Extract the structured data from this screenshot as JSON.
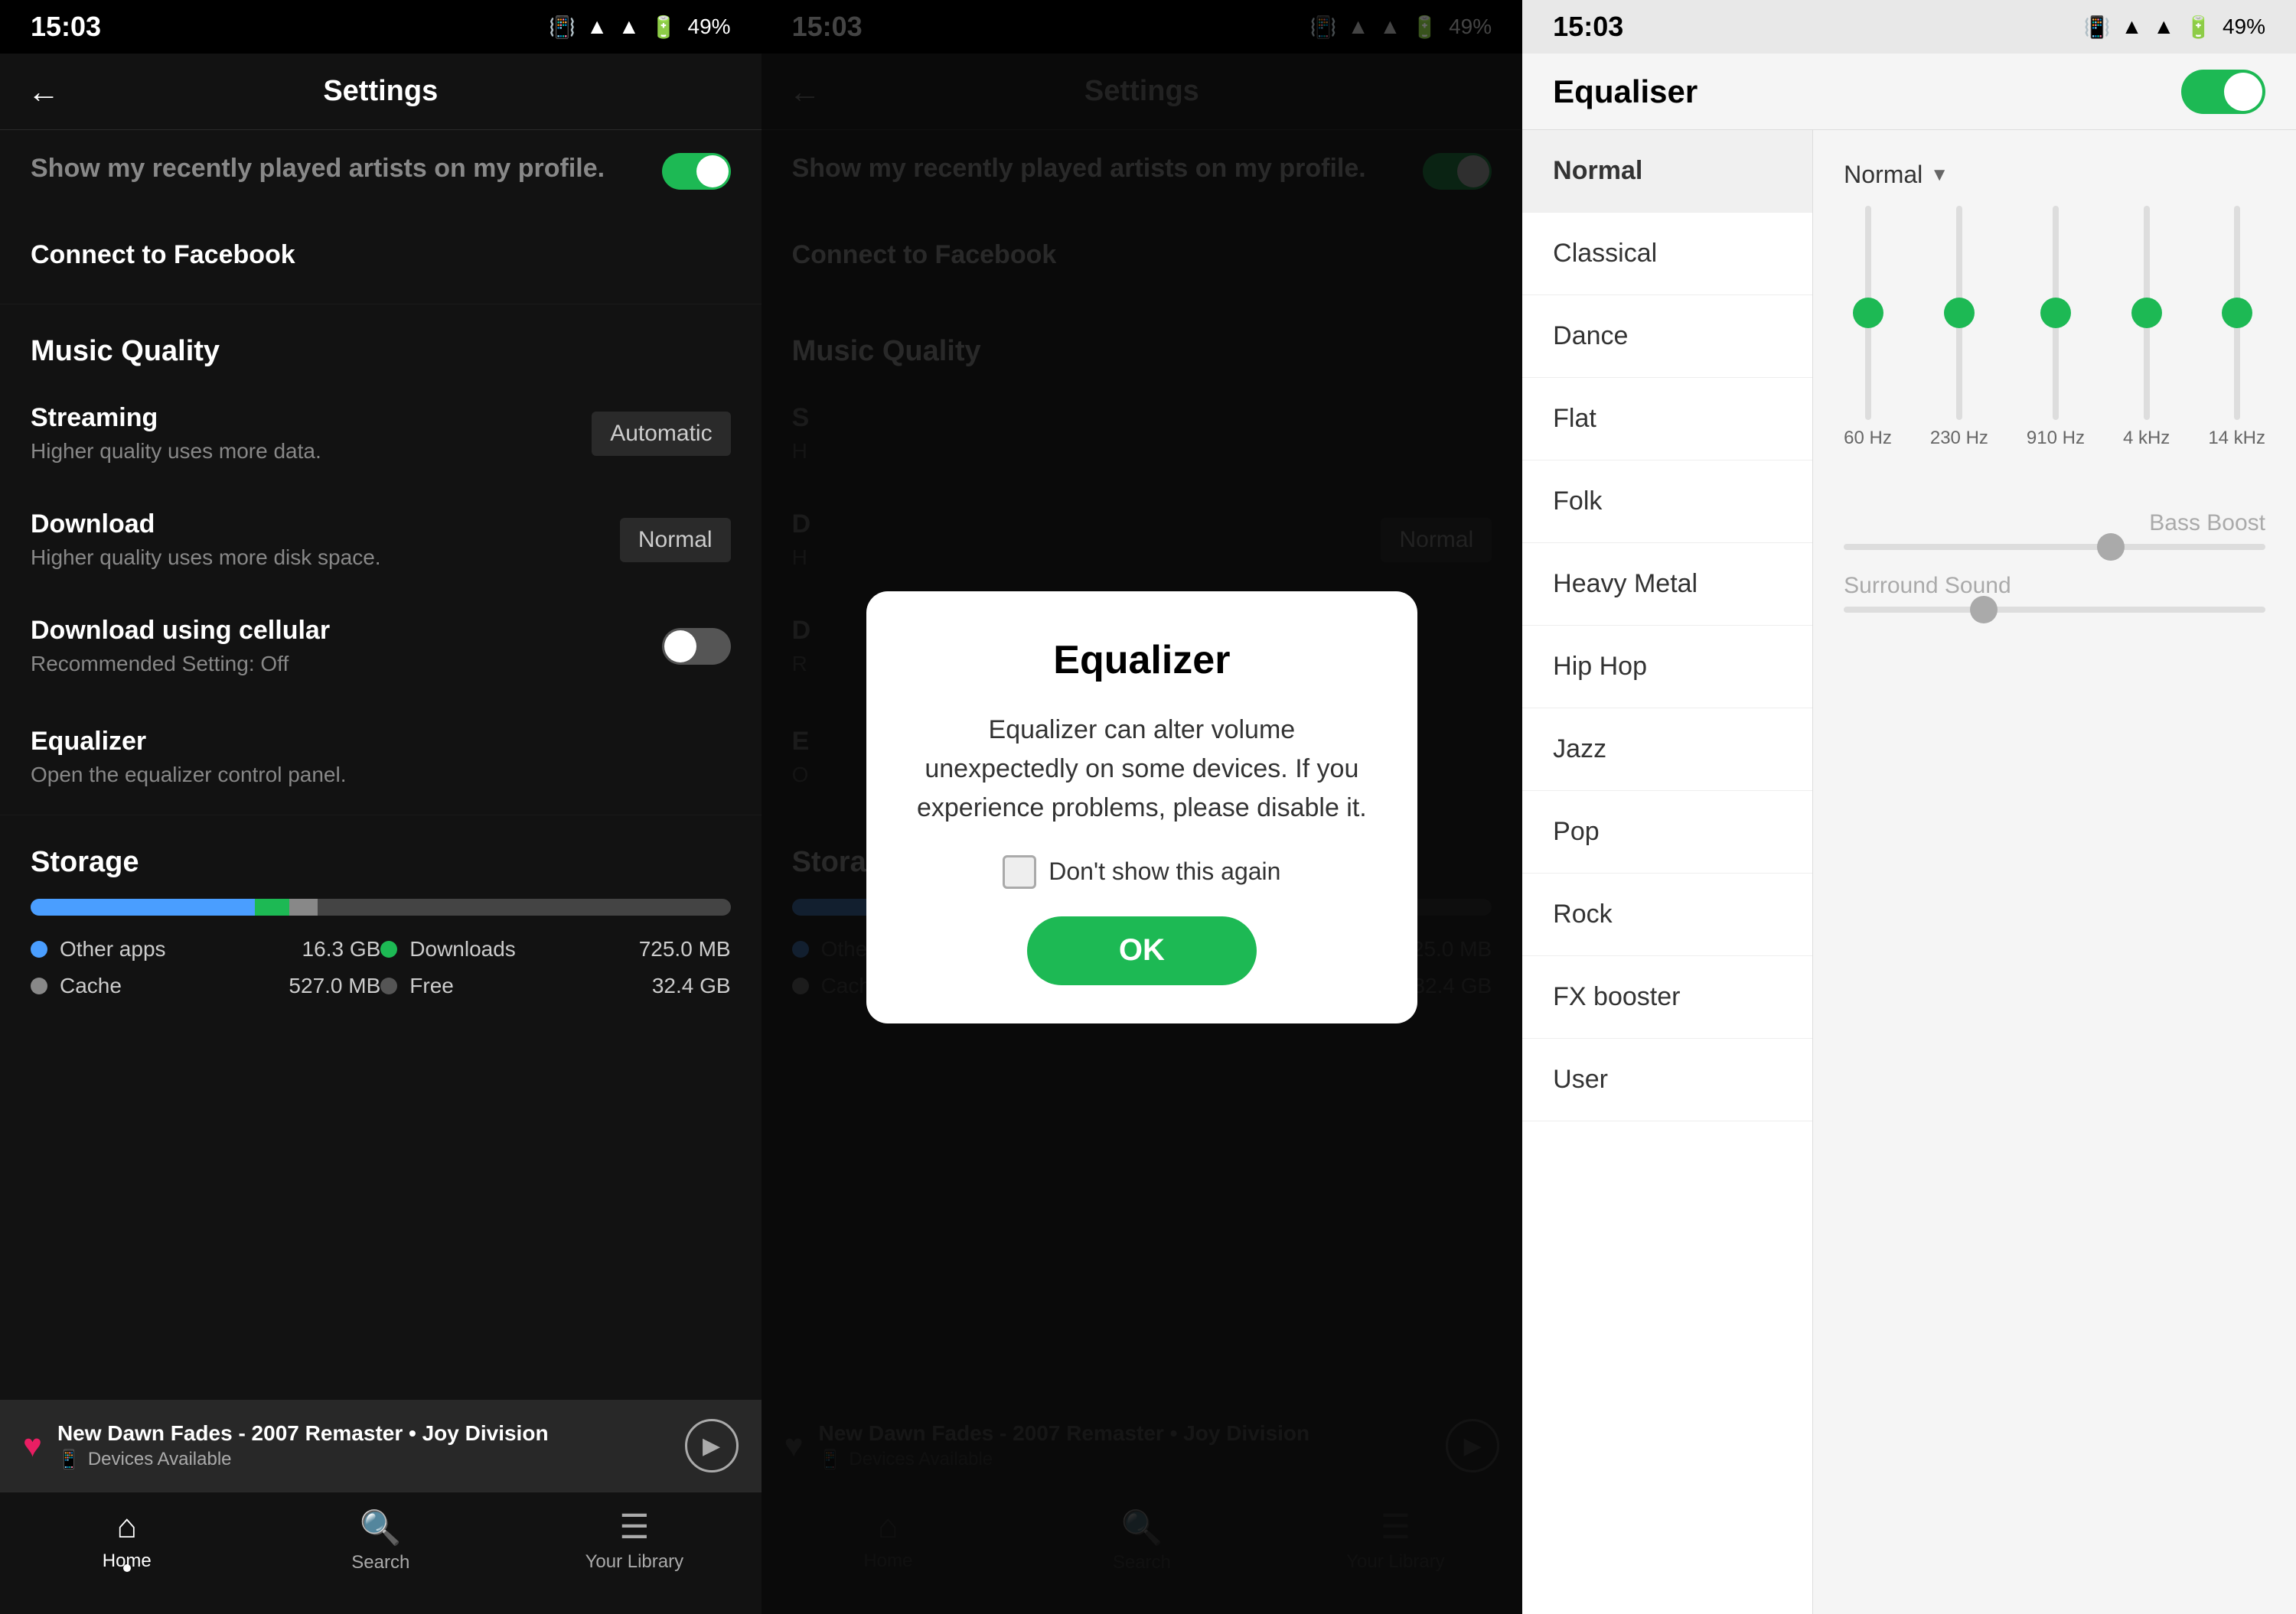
{
  "statusBar": {
    "time": "15:03",
    "battery": "49%"
  },
  "panel1": {
    "title": "Settings",
    "back": "←",
    "recentlyPlayed": "Show my recently played artists on my profile.",
    "connectFacebook": "Connect to Facebook",
    "musicQualitySection": "Music Quality",
    "streamingLabel": "Streaming",
    "streamingDesc": "Higher quality uses more data.",
    "streamingValue": "Automatic",
    "downloadLabel": "Download",
    "downloadDesc": "Higher quality uses more disk space.",
    "downloadValue": "Normal",
    "cellularLabel": "Download using cellular",
    "cellularDesc": "Recommended Setting: Off",
    "equalizerLabel": "Equalizer",
    "equalizerDesc": "Open the equalizer control panel.",
    "storageSection": "Storage",
    "storageItems": [
      {
        "label": "Other apps",
        "value": "16.3 GB",
        "color": "#4a9eff"
      },
      {
        "label": "Downloads",
        "value": "725.0 MB",
        "color": "#1db954"
      },
      {
        "label": "Cache",
        "value": "527.0 MB",
        "color": "#888"
      },
      {
        "label": "Free",
        "value": "32.4 GB",
        "color": "#555"
      }
    ],
    "nowPlayingTitle": "New Dawn Fades - 2007 Remaster • Joy Division",
    "nowPlayingSub": "Devices Available",
    "navItems": [
      {
        "label": "Home",
        "icon": "⌂",
        "active": true
      },
      {
        "label": "Search",
        "icon": "🔍",
        "active": false
      },
      {
        "label": "Your Library",
        "icon": "☰",
        "active": false
      }
    ]
  },
  "panel2": {
    "title": "Settings",
    "modal": {
      "title": "Equalizer",
      "body": "Equalizer can alter volume unexpectedly on some devices. If you experience problems, please disable it.",
      "checkboxLabel": "Don't show this again",
      "okLabel": "OK"
    }
  },
  "panel3": {
    "title": "Equaliser",
    "presets": [
      "Normal",
      "Classical",
      "Dance",
      "Flat",
      "Folk",
      "Heavy Metal",
      "Hip Hop",
      "Jazz",
      "Pop",
      "Rock",
      "FX booster",
      "User"
    ],
    "selectedPreset": "Normal",
    "frequencies": [
      "60 Hz",
      "230 Hz",
      "910 Hz",
      "4 kHz",
      "14 kHz"
    ],
    "sliderPositions": [
      50,
      50,
      50,
      50,
      50
    ],
    "bassBoostLabel": "Bass Boost",
    "surroundSoundLabel": "Surround Sound"
  }
}
